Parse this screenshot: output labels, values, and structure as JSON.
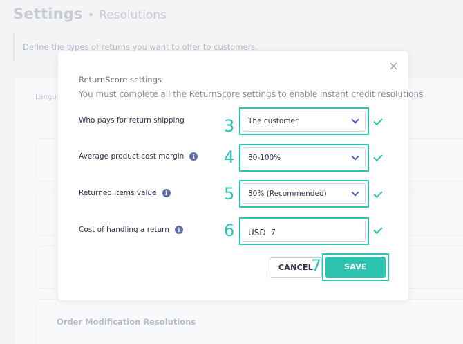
{
  "page": {
    "title": "Settings",
    "separator": "•",
    "subtitle": "Resolutions",
    "description": "Define the types of returns you want to offer to customers.",
    "lang_label": "Langu",
    "order_section": "Order Modification Resolutions"
  },
  "modal": {
    "title": "ReturnScore settings",
    "subtitle": "You must complete all the ReturnScore settings to enable instant credit resolutions",
    "fields": [
      {
        "label": "Who pays for return shipping",
        "has_info": false,
        "step": "3",
        "value": "The customer",
        "type": "select"
      },
      {
        "label": "Average product cost margin",
        "has_info": true,
        "step": "4",
        "value": "80-100%",
        "type": "select"
      },
      {
        "label": "Returned items value",
        "has_info": true,
        "step": "5",
        "value": "80% (Recommended)",
        "type": "select"
      },
      {
        "label": "Cost of handling a return",
        "has_info": true,
        "step": "6",
        "currency": "USD",
        "value": "7",
        "type": "input"
      }
    ],
    "cancel_label": "CANCEL",
    "save_step": "7",
    "save_label": "SAVE",
    "info_glyph": "i"
  },
  "colors": {
    "accent": "#2cc4b0",
    "chevron": "#4a63c9",
    "info": "#5f6fa3"
  }
}
